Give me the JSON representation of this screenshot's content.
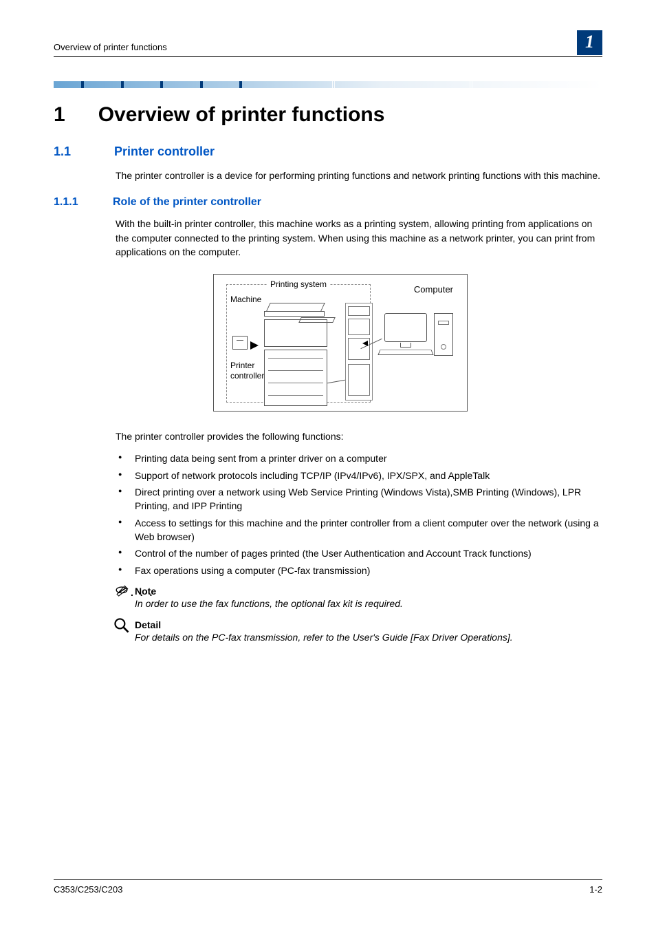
{
  "header": {
    "running_title": "Overview of printer functions",
    "chapter_badge": "1"
  },
  "chapter": {
    "number": "1",
    "title": "Overview of printer functions"
  },
  "section": {
    "number": "1.1",
    "title": "Printer controller",
    "intro": "The printer controller is a device for performing printing functions and network printing functions with this machine."
  },
  "subsection": {
    "number": "1.1.1",
    "title": "Role of the printer controller",
    "intro": "With the built-in printer controller, this machine works as a printing system, allowing printing from applications on the computer connected to the printing system. When using this machine as a network printer, you can print from applications on the computer.",
    "diagram": {
      "printing_system_label": "Printing system",
      "machine_label": "Machine",
      "computer_label": "Computer",
      "printer_controller_label_line1": "Printer",
      "printer_controller_label_line2": "controller"
    },
    "functions_intro": "The printer controller provides the following functions:",
    "functions": [
      "Printing data being sent from a printer driver on a computer",
      "Support of network protocols including TCP/IP (IPv4/IPv6), IPX/SPX, and AppleTalk",
      "Direct printing over a network using Web Service Printing (Windows Vista),SMB Printing (Windows), LPR Printing, and IPP Printing",
      "Access to settings for this machine and the printer controller from a client computer over the network (using a Web browser)",
      "Control of the number of pages printed (the User Authentication and Account Track functions)",
      "Fax operations using a computer (PC-fax transmission)"
    ]
  },
  "note": {
    "heading": "Note",
    "body": "In order to use the fax functions, the optional fax kit is required."
  },
  "detail": {
    "heading": "Detail",
    "body": "For details on the PC-fax transmission, refer to the User's Guide [Fax Driver Operations]."
  },
  "footer": {
    "model": "C353/C253/C203",
    "page": "1-2"
  }
}
